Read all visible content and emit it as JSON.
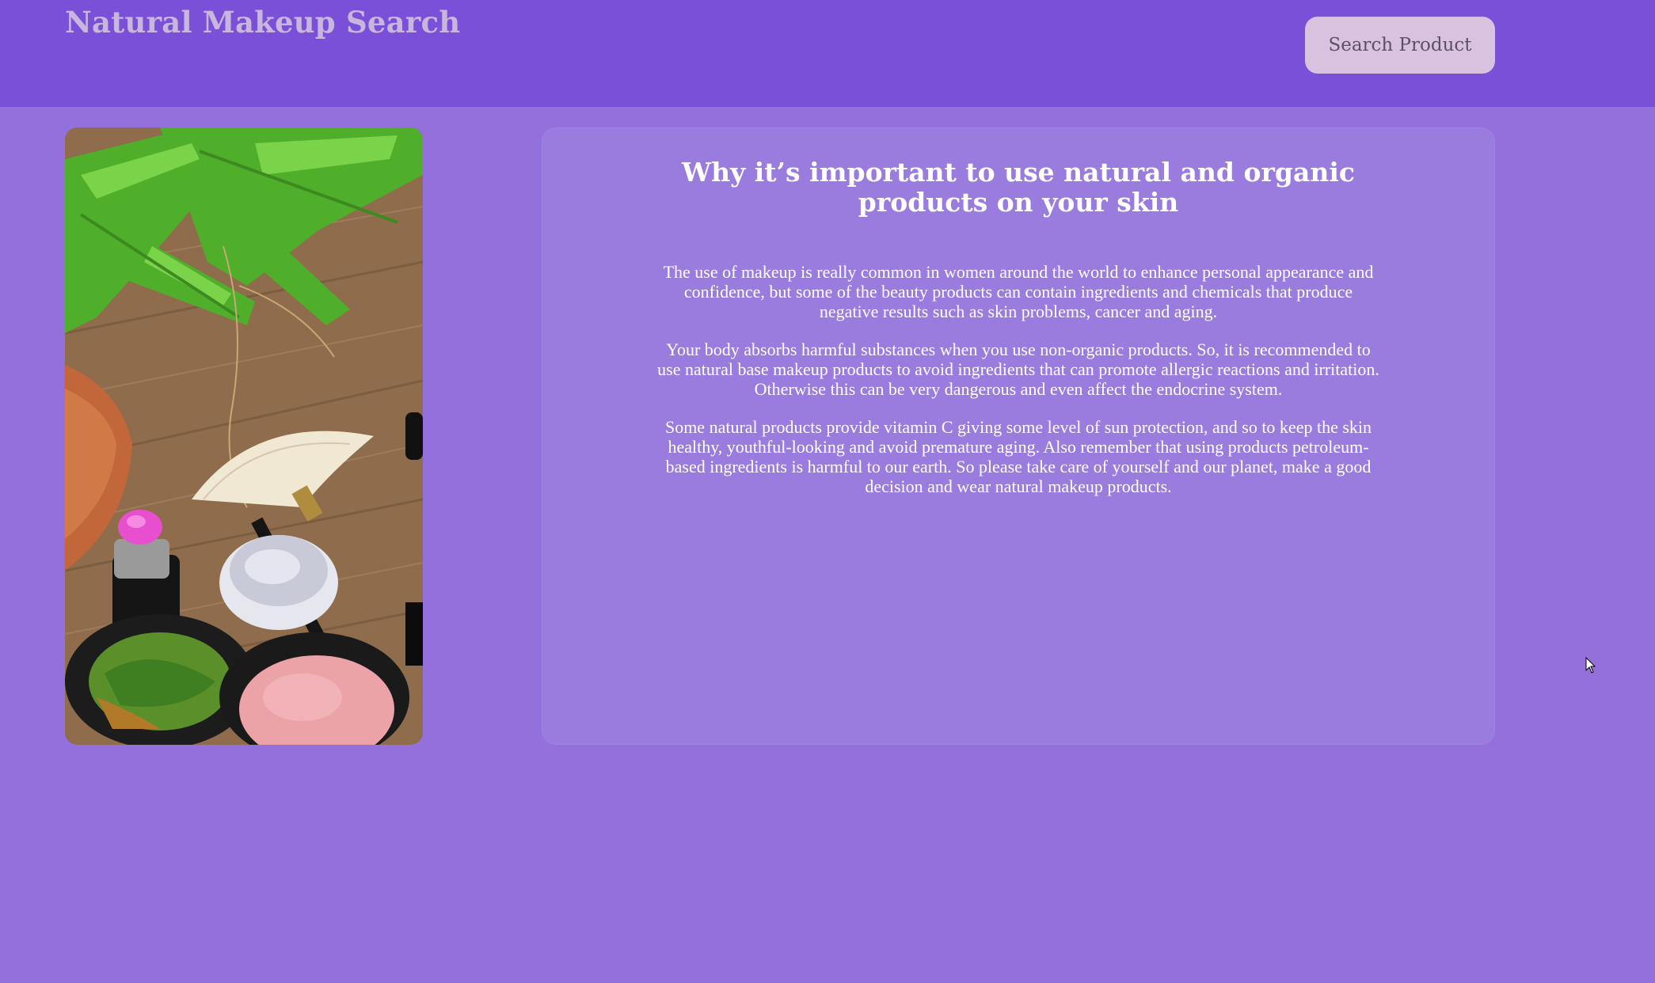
{
  "header": {
    "title": "Natural Makeup Search",
    "search_button_label": "Search Product"
  },
  "hero_image": {
    "alt": "makeup products on wooden table with fern plant"
  },
  "article": {
    "heading_line1": "Why it’s important to use natural and organic",
    "heading_line2": "products on your skin",
    "paragraphs": [
      "The use of makeup is really common in women around the world to enhance personal appearance and confidence, but some of the beauty products can contain ingredients and chemicals that produce negative results such as skin problems, cancer and aging.",
      "Your body absorbs harmful substances when you use non-organic products. So, it is recommended to use natural base makeup products to avoid ingredients that can promote allergic reactions and irritation. Otherwise this can be very dangerous and even affect the endocrine system.",
      "Some natural products provide vitamin C giving some level of sun protection, and so to keep the skin healthy, youthful-looking and avoid premature aging. Also remember that using products petroleum-based ingredients is harmful to our earth. So please take care of yourself and our planet, make a good decision and wear natural makeup products."
    ]
  },
  "colors": {
    "page_background": "#9370db",
    "header_background": "#7b50d8",
    "card_background": "#9a7cde",
    "title_color": "#c9b6dc",
    "button_background": "#d9c1e0"
  },
  "icons": {
    "cursor": "mouse-pointer-icon"
  }
}
